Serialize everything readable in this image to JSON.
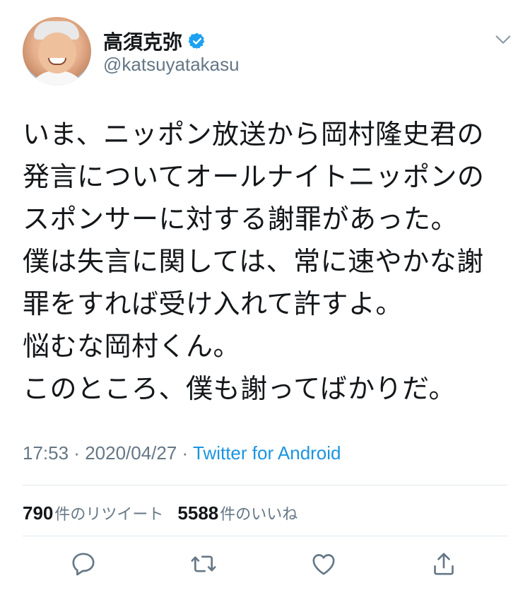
{
  "user": {
    "name": "高須克弥",
    "handle": "@katsuyatakasu",
    "verified": true
  },
  "tweet": {
    "lines": [
      "いま、ニッポン放送から岡村隆史君の",
      "発言についてオールナイトニッポンの",
      "スポンサーに対する謝罪があった。",
      "僕は失言に関しては、常に速やかな謝",
      "罪をすれば受け入れて許すよ。",
      "悩むな岡村くん。",
      "このところ、僕も謝ってばかりだ。"
    ],
    "time": "17:53",
    "separator": " · ",
    "date": "2020/04/27",
    "source": "Twitter for Android"
  },
  "stats": {
    "retweets": "790",
    "retweets_label": "件のリツイート",
    "likes": "5588",
    "likes_label": "件のいいね"
  },
  "actions": {
    "reply": "reply-icon",
    "retweet": "retweet-icon",
    "like": "heart-icon",
    "share": "share-icon"
  },
  "colors": {
    "text": "#14171a",
    "secondary": "#657786",
    "link": "#1b95e0",
    "verified": "#1da1f2",
    "divider": "#e1e8ed"
  }
}
